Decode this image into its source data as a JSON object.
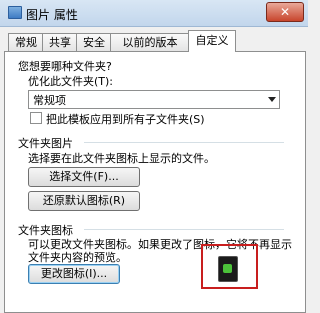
{
  "window": {
    "title": "图片 属性",
    "close_glyph": "✕"
  },
  "tabs": [
    {
      "label": "常规",
      "active": false
    },
    {
      "label": "共享",
      "active": false
    },
    {
      "label": "安全",
      "active": false
    },
    {
      "label": "以前的版本",
      "active": false
    },
    {
      "label": "自定义",
      "active": true
    }
  ],
  "folder_type": {
    "question": "您想要哪种文件夹?",
    "optimize_label": "优化此文件夹(T):",
    "selected_value": "常规项",
    "apply_subfolders_label": "把此模板应用到所有子文件夹(S)",
    "apply_subfolders_checked": false
  },
  "folder_pictures": {
    "heading": "文件夹图片",
    "description": "选择要在此文件夹图标上显示的文件。",
    "choose_file_button": "选择文件(F)...",
    "restore_default_button": "还原默认图标(R)"
  },
  "folder_icons": {
    "heading": "文件夹图标",
    "description_line1": "可以更改文件夹图标。如果更改了图标，它将不再显示",
    "description_line2": "文件夹内容的预览。",
    "change_icon_button": "更改图标(I)...",
    "preview_icon": "folder-icon-preview"
  },
  "colors": {
    "highlight_border": "#c81e1e",
    "icon_accent": "#4cc23a"
  }
}
